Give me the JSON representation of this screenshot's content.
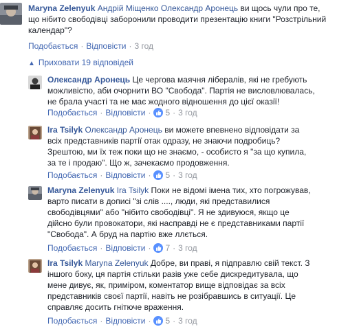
{
  "comments": [
    {
      "author": "Maryna Zelenyuk",
      "mentions": "Андрій Міщенко Олександр Аронець",
      "lines": [
        "ви щось чули про те,",
        "що нібито свободівці заборонили проводити презентацію книги \"Розстрільний",
        "календар\"?"
      ],
      "like": "Подобається",
      "reply": "Відповісти",
      "time": "3 год"
    },
    {
      "author": "Олександр Аронець",
      "lines": [
        "Це чергова маячня лібералів, які не гребують",
        "можливістю, аби очорнити ВО \"Свобода\". Партія не висловлювалась,",
        "не брала участі та не має жодного відношення до цієї оказії!"
      ],
      "like": "Подобається",
      "reply": "Відповісти",
      "reactions": "5",
      "time": "3 год"
    },
    {
      "author": "Ira Tsilyk",
      "mentions": "Олександр Аронець",
      "lines": [
        "ви можете впевнено відповідати за",
        "всіх представників партії отак одразу, не знаючи подробиць?",
        "Зрештою, ми їх теж поки що не знаємо, - особисто я \"за що купила,",
        "за те і продаю\". Що ж, зачекаємо продовження."
      ],
      "like": "Подобається",
      "reply": "Відповісти",
      "reactions": "5",
      "time": "3 год"
    },
    {
      "author": "Maryna Zelenyuk",
      "mentions": "Ira Tsilyk",
      "lines": [
        "Поки не відомі імена тих, хто погрожував,",
        "варто писати в дописі \"зі слів ...., люди, які представилися",
        "свободівцями\" або \"нібито свободівці\". Я не здивуюся, якщо це",
        "дійсно були провокатори, які насправді не є представниками партії",
        "\"Свобода\". А бруд на партію вже ллється."
      ],
      "like": "Подобається",
      "reply": "Відповісти",
      "reactions": "7",
      "time": "3 год"
    },
    {
      "author": "Ira Tsilyk",
      "mentions": "Maryna Zelenyuk",
      "lines": [
        "Добре, ви праві, я підправлю свій текст. З",
        "іншого боку, ця партія стільки разів уже себе дискредитувала, що",
        "мене дивує, як, приміром, коментатор вище відповідає за всіх",
        "представників своєї партії, навіть не розібравшись в ситуації. Це",
        "справляє досить гнітюче враження."
      ],
      "like": "Подобається",
      "reply": "Відповісти",
      "reactions": "5",
      "time": "3 год"
    }
  ],
  "hidden_replies": "Приховати 19 відповідей",
  "icons": {
    "reaction": "like-icon",
    "collapse": "arrow-up-icon"
  },
  "colors": {
    "link": "#365899",
    "action": "#4267b2",
    "meta": "#90949c",
    "like_bubble": "#5890ff"
  }
}
